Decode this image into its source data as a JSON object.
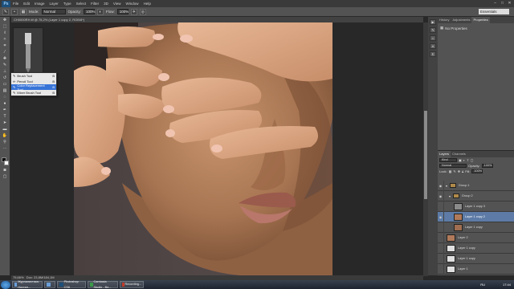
{
  "app": {
    "logo": "Ps"
  },
  "menu": [
    "File",
    "Edit",
    "Image",
    "Layer",
    "Type",
    "Select",
    "Filter",
    "3D",
    "View",
    "Window",
    "Help"
  ],
  "window_controls": [
    "–",
    "□",
    "✕"
  ],
  "options": {
    "mode_label": "Mode:",
    "mode_value": "Normal",
    "opacity_label": "Opacity:",
    "opacity_value": "100%",
    "flow_label": "Flow:",
    "flow_value": "100%",
    "workspace": "Essentials"
  },
  "document": {
    "tab_title": "CH0000RH.tif @ 75,2% (Layer 1 copy 2, RGB/8*)",
    "zoom": "75,66%",
    "doc_info": "Doc: 23,8M/184,1M"
  },
  "flyout": {
    "items": [
      {
        "label": "Brush Tool",
        "key": "B"
      },
      {
        "label": "Pencil Tool",
        "key": "B"
      },
      {
        "label": "Color Replacement Tool",
        "key": "B"
      },
      {
        "label": "Mixer Brush Tool",
        "key": "B"
      }
    ]
  },
  "right_panel": {
    "tabs": [
      "History",
      "Adjustments",
      "Properties"
    ],
    "props_title": "No Properties"
  },
  "layers_panel": {
    "tabs": [
      "Layers",
      "Channels"
    ],
    "kind_label": "Kind",
    "blend_mode": "Normal",
    "opacity_label": "Opacity:",
    "opacity_value": "100%",
    "lock_label": "Lock:",
    "fill_label": "Fill:",
    "fill_value": "100%",
    "layers": [
      {
        "name": "Group 1",
        "type": "group"
      },
      {
        "name": "Group 2",
        "type": "group"
      },
      {
        "name": "Layer 1 copy 3",
        "type": "layer"
      },
      {
        "name": "Layer 1 copy 2",
        "type": "layer",
        "selected": true
      },
      {
        "name": "Layer 1 copy",
        "type": "layer"
      },
      {
        "name": "Layer 2",
        "type": "layer"
      },
      {
        "name": "Layer 1 copy",
        "type": "layer"
      },
      {
        "name": "Layer 1 copy",
        "type": "layer"
      },
      {
        "name": "Layer 1",
        "type": "layer"
      }
    ]
  },
  "taskbar": {
    "tasks": [
      "Журналистика. Ностал...",
      "",
      "Photoshop CS6",
      "Camtasia Studio - Be...",
      "Recording..."
    ],
    "lang": "RU",
    "clock": "17:44"
  },
  "colors": {
    "chrome_dark": "#282828",
    "panel": "#535353",
    "selected_layer": "#5d7ba6",
    "flyout_highlight": "#3874d8"
  }
}
